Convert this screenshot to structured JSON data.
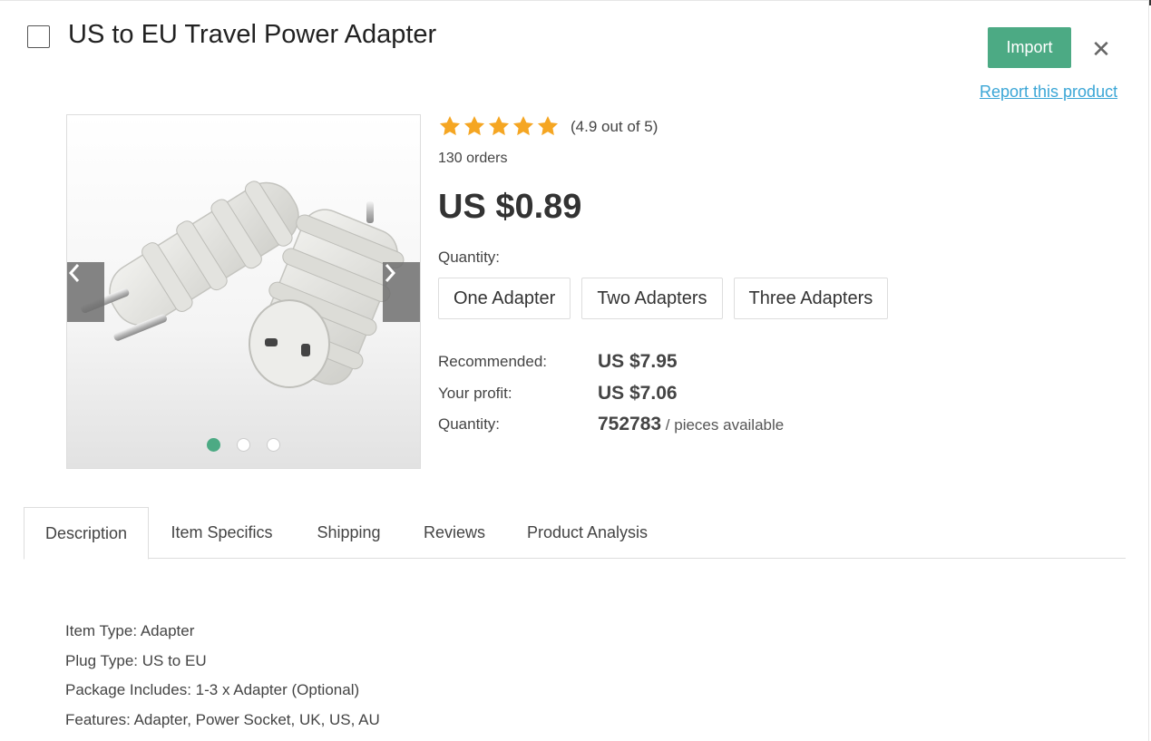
{
  "product": {
    "title": "US to EU Travel Power Adapter",
    "rating_text": "(4.9 out of 5)",
    "rating": 4.9,
    "rating_max": 5,
    "orders": "130 orders",
    "price": "US $0.89"
  },
  "header": {
    "import_label": "Import",
    "close_symbol": "✕",
    "report_label": "Report this product"
  },
  "gallery": {
    "image_count": 3,
    "active_index": 0,
    "prev_icon": "chevron-left-icon",
    "next_icon": "chevron-right-icon"
  },
  "quantity": {
    "label": "Quantity:",
    "options": [
      "One Adapter",
      "Two Adapters",
      "Three Adapters"
    ]
  },
  "pricing": {
    "recommended_label": "Recommended:",
    "recommended_value": "US $7.95",
    "profit_label": "Your profit:",
    "profit_value": "US $7.06",
    "quantity_label": "Quantity:",
    "quantity_value": "752783",
    "quantity_suffix": " / pieces available"
  },
  "tabs": [
    "Description",
    "Item Specifics",
    "Shipping",
    "Reviews",
    "Product Analysis"
  ],
  "active_tab": "Description",
  "description": [
    "Item Type: Adapter",
    "Plug Type: US to EU",
    "Package Includes: 1-3 x Adapter (Optional)",
    "Features: Adapter, Power Socket, UK, US, AU"
  ],
  "colors": {
    "accent": "#4caa84",
    "link": "#3ba6d6",
    "star": "#f5a623"
  }
}
